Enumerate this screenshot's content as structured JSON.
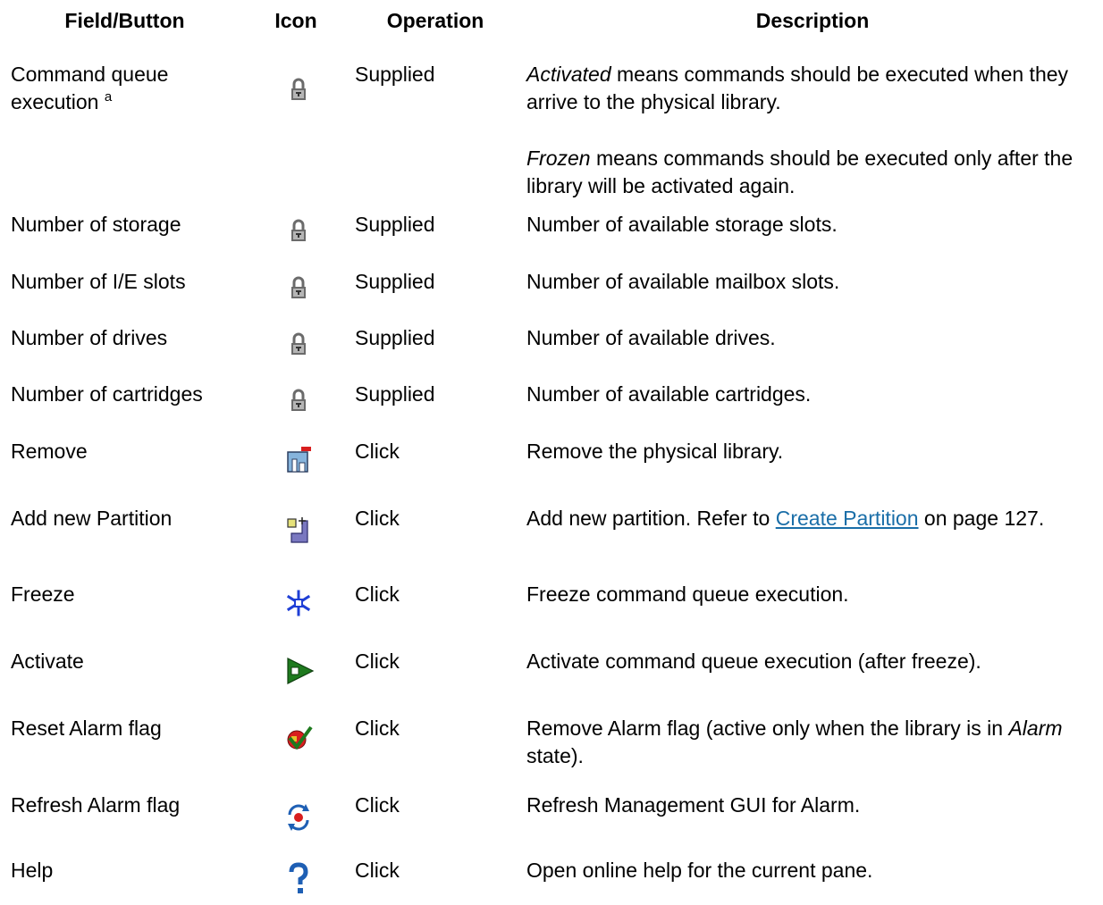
{
  "headers": {
    "field": "Field/Button",
    "icon": "Icon",
    "operation": "Operation",
    "description": "Description"
  },
  "rows": [
    {
      "field": "Command queue execution",
      "field_sup": "a",
      "icon": "lock-icon",
      "operation": "Supplied",
      "desc1": {
        "em": "Activated",
        "text": " means commands should be executed when they arrive to the physical library."
      },
      "desc2": {
        "em": "Frozen",
        "text": " means commands should be executed only after the library will be activated again."
      }
    },
    {
      "field": "Number of storage",
      "icon": "lock-icon",
      "operation": "Supplied",
      "description": "Number of available storage slots."
    },
    {
      "field": "Number of I/E slots",
      "icon": "lock-icon",
      "operation": "Supplied",
      "description": "Number of available mailbox slots."
    },
    {
      "field": "Number of drives",
      "icon": "lock-icon",
      "operation": "Supplied",
      "description": "Number of available drives."
    },
    {
      "field": "Number of cartridges",
      "icon": "lock-icon",
      "operation": "Supplied",
      "description": "Number of available cartridges."
    },
    {
      "field": "Remove",
      "icon": "remove-library-icon",
      "operation": "Click",
      "description": "Remove the physical library."
    },
    {
      "field": "Add new Partition",
      "icon": "add-partition-icon",
      "operation": "Click",
      "desc_before": "Add new partition. Refer to ",
      "desc_link": "Create Partition",
      "desc_after": " on page 127."
    },
    {
      "field": "Freeze",
      "icon": "snowflake-icon",
      "operation": "Click",
      "description": "Freeze command queue execution."
    },
    {
      "field": "Activate",
      "icon": "activate-arrow-icon",
      "operation": "Click",
      "description": "Activate command queue execution (after freeze)."
    },
    {
      "field": "Reset Alarm flag",
      "icon": "reset-alarm-icon",
      "operation": "Click",
      "desc_before": "Remove Alarm flag (active only when the library is in ",
      "desc_em": "Alarm",
      "desc_after": " state)."
    },
    {
      "field": "Refresh Alarm flag",
      "icon": "refresh-alarm-icon",
      "operation": "Click",
      "description": "Refresh Management GUI for Alarm."
    },
    {
      "field": "Help",
      "icon": "help-icon",
      "operation": "Click",
      "description": "Open online help for the current pane."
    }
  ],
  "colors": {
    "text": "#000000",
    "link": "#1a6ea8",
    "lock": "#6b6b6b",
    "library": "#86b4dc",
    "alert_red": "#d81e1e",
    "snowflake": "#1f3fd6",
    "activate_green": "#1e7a1e",
    "help_blue": "#1e5fb4",
    "partition_purple": "#7a78c0",
    "partition_yellow": "#e6e27a"
  }
}
